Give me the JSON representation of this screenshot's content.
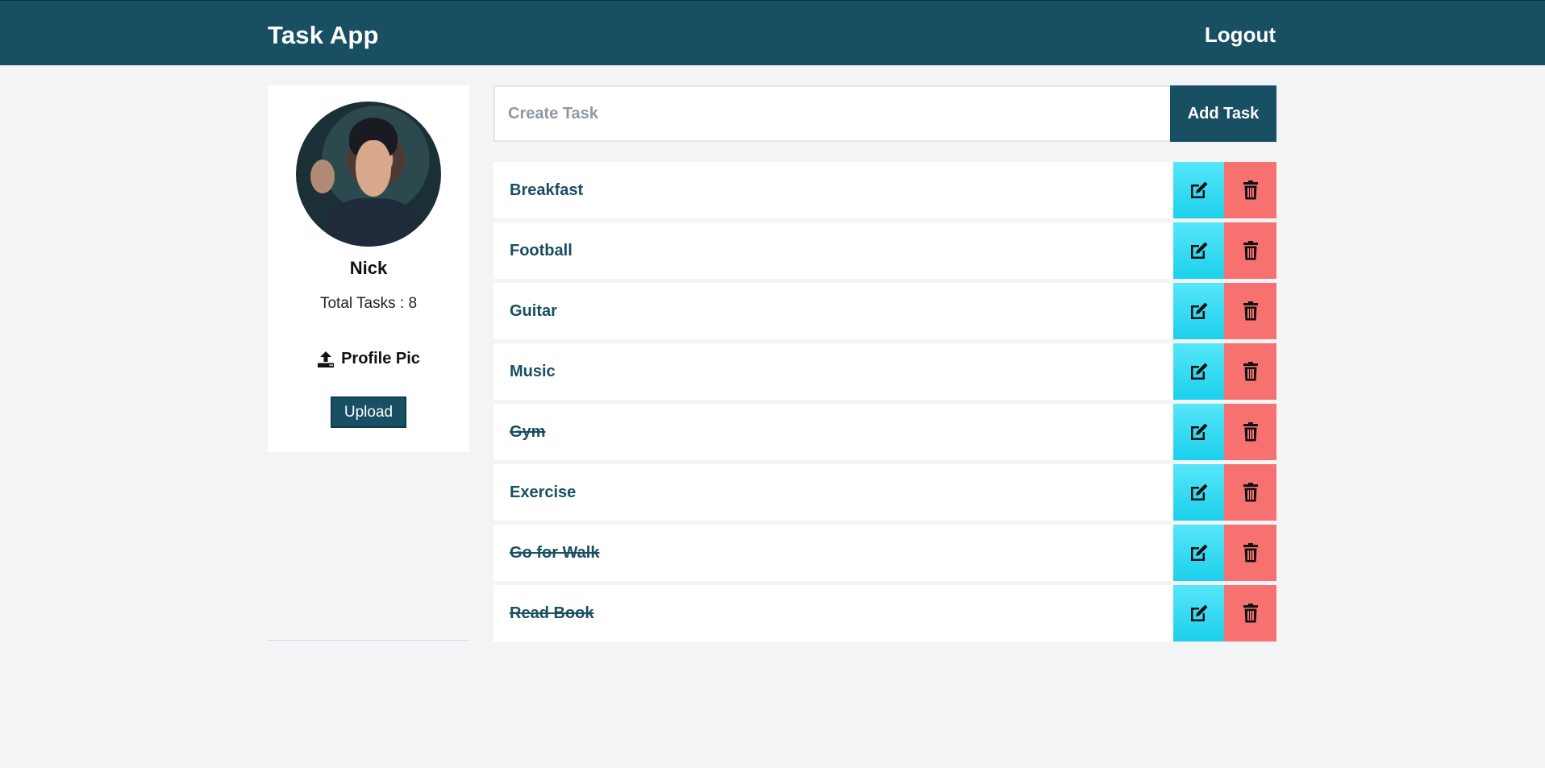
{
  "header": {
    "brand": "Task App",
    "logout_label": "Logout"
  },
  "profile": {
    "name": "Nick",
    "total_tasks_text": "Total Tasks : 8",
    "profile_pic_label": "Profile Pic",
    "upload_label": "Upload"
  },
  "create_task": {
    "placeholder": "Create Task",
    "value": "",
    "add_label": "Add Task"
  },
  "tasks": [
    {
      "title": "Breakfast",
      "completed": false
    },
    {
      "title": "Football",
      "completed": false
    },
    {
      "title": "Guitar",
      "completed": false
    },
    {
      "title": "Music",
      "completed": false
    },
    {
      "title": "Gym",
      "completed": true
    },
    {
      "title": "Exercise",
      "completed": false
    },
    {
      "title": "Go for Walk",
      "completed": true
    },
    {
      "title": "Read Book",
      "completed": true
    }
  ],
  "icons": {
    "edit": "edit-icon",
    "delete": "trash-icon",
    "upload": "upload-icon"
  },
  "colors": {
    "primary": "#184f63",
    "edit": "#1cd0ec",
    "delete": "#f87171",
    "background": "#f3f4f6"
  }
}
